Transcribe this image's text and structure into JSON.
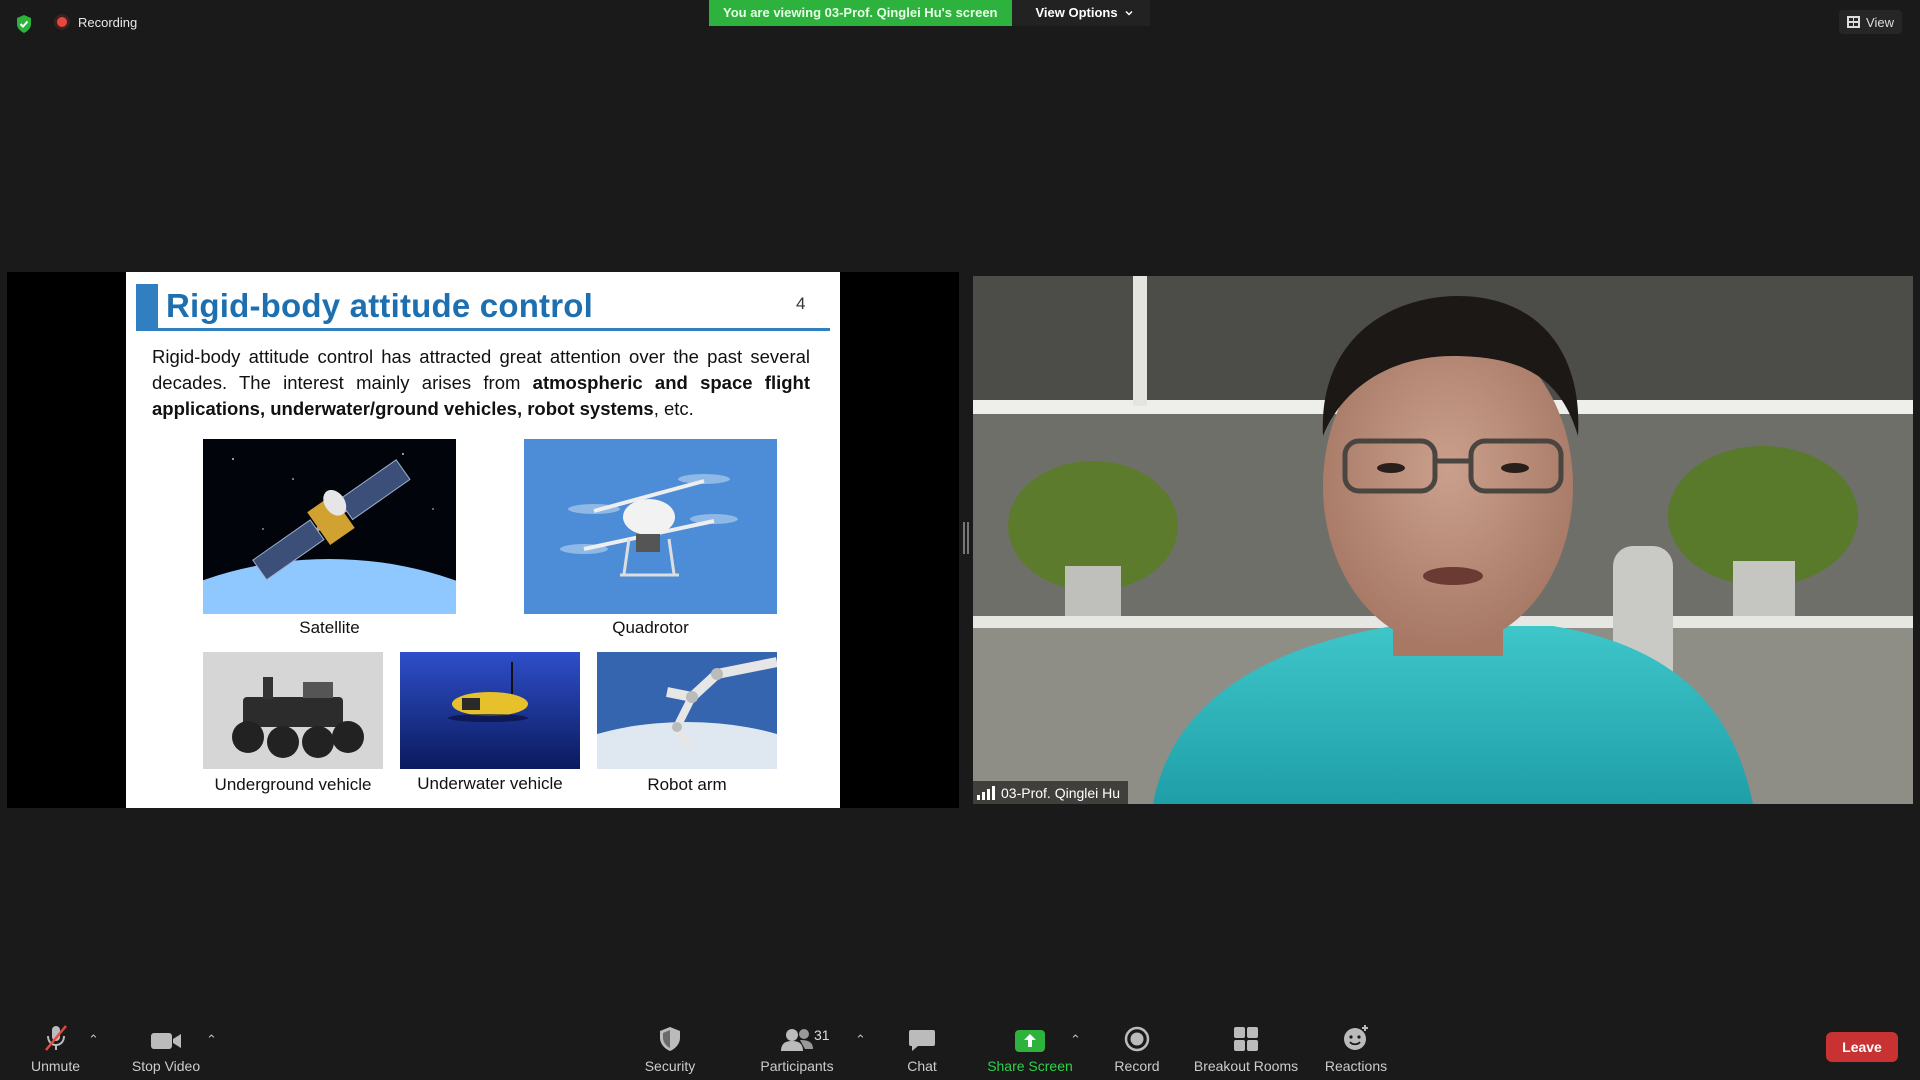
{
  "top": {
    "recording_label": "Recording",
    "banner_text": "You are viewing 03-Prof. Qinglei Hu's screen",
    "view_options_label": "View Options",
    "view_label": "View"
  },
  "slide": {
    "title": "Rigid-body attitude control",
    "page_number": "4",
    "body_plain_1": "Rigid-body attitude control has attracted great attention over the past several decades. The interest mainly arises from ",
    "body_bold": "atmospheric and space flight applications, underwater/ground vehicles, robot systems",
    "body_plain_2": ", etc.",
    "captions": {
      "satellite": "Satellite",
      "quadrotor": "Quadrotor",
      "underground": "Underground vehicle",
      "underwater": "Underwater vehicle",
      "robot_arm": "Robot arm"
    }
  },
  "video": {
    "participant_name": "03-Prof. Qinglei Hu"
  },
  "toolbar": {
    "unmute": "Unmute",
    "stop_video": "Stop Video",
    "security": "Security",
    "participants": "Participants",
    "participant_count": "31",
    "chat": "Chat",
    "share_screen": "Share Screen",
    "record": "Record",
    "breakout_rooms": "Breakout Rooms",
    "reactions": "Reactions",
    "leave": "Leave"
  },
  "colors": {
    "accent_green": "#2db23d",
    "slide_blue": "#1d6fb0",
    "leave_red": "#c83232"
  }
}
